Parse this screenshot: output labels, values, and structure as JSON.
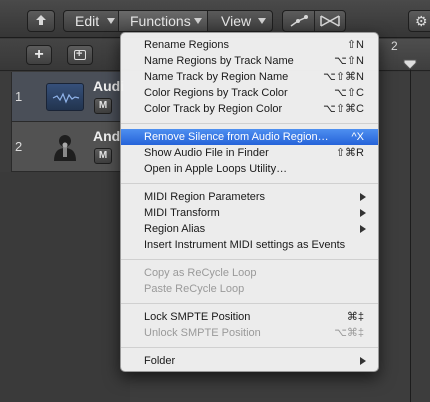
{
  "toolbar": {
    "menus": {
      "edit": "Edit",
      "functions": "Functions",
      "view": "View"
    }
  },
  "ruler": {
    "bar_number": "2"
  },
  "tracks": [
    {
      "index": "1",
      "name": "Audi",
      "mute": "M"
    },
    {
      "index": "2",
      "name": "Andr",
      "mute": "M"
    }
  ],
  "functions_menu": {
    "items": [
      {
        "label": "Rename Regions",
        "shortcut": "⇧N"
      },
      {
        "label": "Name Regions by Track Name",
        "shortcut": "⌥⇧N"
      },
      {
        "label": "Name Track by Region Name",
        "shortcut": "⌥⇧⌘N"
      },
      {
        "label": "Color Regions by Track Color",
        "shortcut": "⌥⇧C"
      },
      {
        "label": "Color Track by Region Color",
        "shortcut": "⌥⇧⌘C"
      },
      {
        "label": "Remove Silence from Audio Region…",
        "shortcut": "^X"
      },
      {
        "label": "Show Audio File in Finder",
        "shortcut": "⇧⌘R"
      },
      {
        "label": "Open in Apple Loops Utility…",
        "shortcut": ""
      },
      {
        "label": "MIDI Region Parameters",
        "shortcut": ""
      },
      {
        "label": "MIDI Transform",
        "shortcut": ""
      },
      {
        "label": "Region Alias",
        "shortcut": ""
      },
      {
        "label": "Insert Instrument MIDI settings as Events",
        "shortcut": ""
      },
      {
        "label": "Copy as ReCycle Loop",
        "shortcut": ""
      },
      {
        "label": "Paste ReCycle Loop",
        "shortcut": ""
      },
      {
        "label": "Lock SMPTE Position",
        "shortcut": "⌘‡"
      },
      {
        "label": "Unlock SMPTE Position",
        "shortcut": "⌥⌘‡"
      },
      {
        "label": "Folder",
        "shortcut": ""
      }
    ]
  },
  "colors": {
    "highlight": "#2f6fe0",
    "menu_bg": "#f2f2f2",
    "toolbar": "#3e3e3e"
  }
}
